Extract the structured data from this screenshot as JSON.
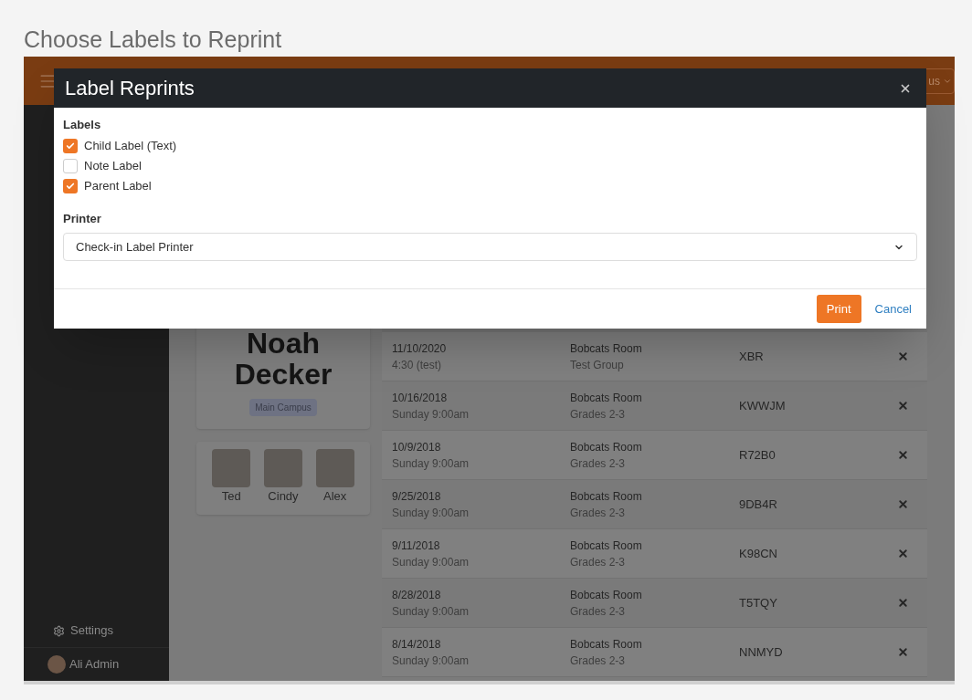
{
  "page_title": "Choose Labels to Reprint",
  "header": {
    "button": "us"
  },
  "sidebar": {
    "items": [
      {
        "label": "Settings"
      }
    ],
    "user": "Ali Admin"
  },
  "person": {
    "first_name": "Noah",
    "last_name": "Decker",
    "campus": "Main Campus"
  },
  "family": [
    {
      "name": "Ted"
    },
    {
      "name": "Cindy"
    },
    {
      "name": "Alex"
    }
  ],
  "attendance": {
    "rows": [
      {
        "date": "11/10/2020",
        "time": "4:30 (test)",
        "location": "Bobcats Room",
        "group": "Test Group",
        "code": "XBR"
      },
      {
        "date": "10/16/2018",
        "time": "Sunday 9:00am",
        "location": "Bobcats Room",
        "group": "Grades 2-3",
        "code": "KWWJM"
      },
      {
        "date": "10/9/2018",
        "time": "Sunday 9:00am",
        "location": "Bobcats Room",
        "group": "Grades 2-3",
        "code": "R72B0"
      },
      {
        "date": "9/25/2018",
        "time": "Sunday 9:00am",
        "location": "Bobcats Room",
        "group": "Grades 2-3",
        "code": "9DB4R"
      },
      {
        "date": "9/11/2018",
        "time": "Sunday 9:00am",
        "location": "Bobcats Room",
        "group": "Grades 2-3",
        "code": "K98CN"
      },
      {
        "date": "8/28/2018",
        "time": "Sunday 9:00am",
        "location": "Bobcats Room",
        "group": "Grades 2-3",
        "code": "T5TQY"
      },
      {
        "date": "8/14/2018",
        "time": "Sunday 9:00am",
        "location": "Bobcats Room",
        "group": "Grades 2-3",
        "code": "NNMYD"
      }
    ]
  },
  "modal": {
    "title": "Label Reprints",
    "labels_heading": "Labels",
    "labels": [
      {
        "label": "Child Label (Text)",
        "checked": true
      },
      {
        "label": "Note Label",
        "checked": false
      },
      {
        "label": "Parent Label",
        "checked": true
      }
    ],
    "printer_label": "Printer",
    "printer": {
      "value": "Check-in Label Printer"
    },
    "buttons": [
      {
        "label": "Print",
        "kind": "primary"
      },
      {
        "label": "Cancel",
        "kind": "link"
      }
    ]
  }
}
